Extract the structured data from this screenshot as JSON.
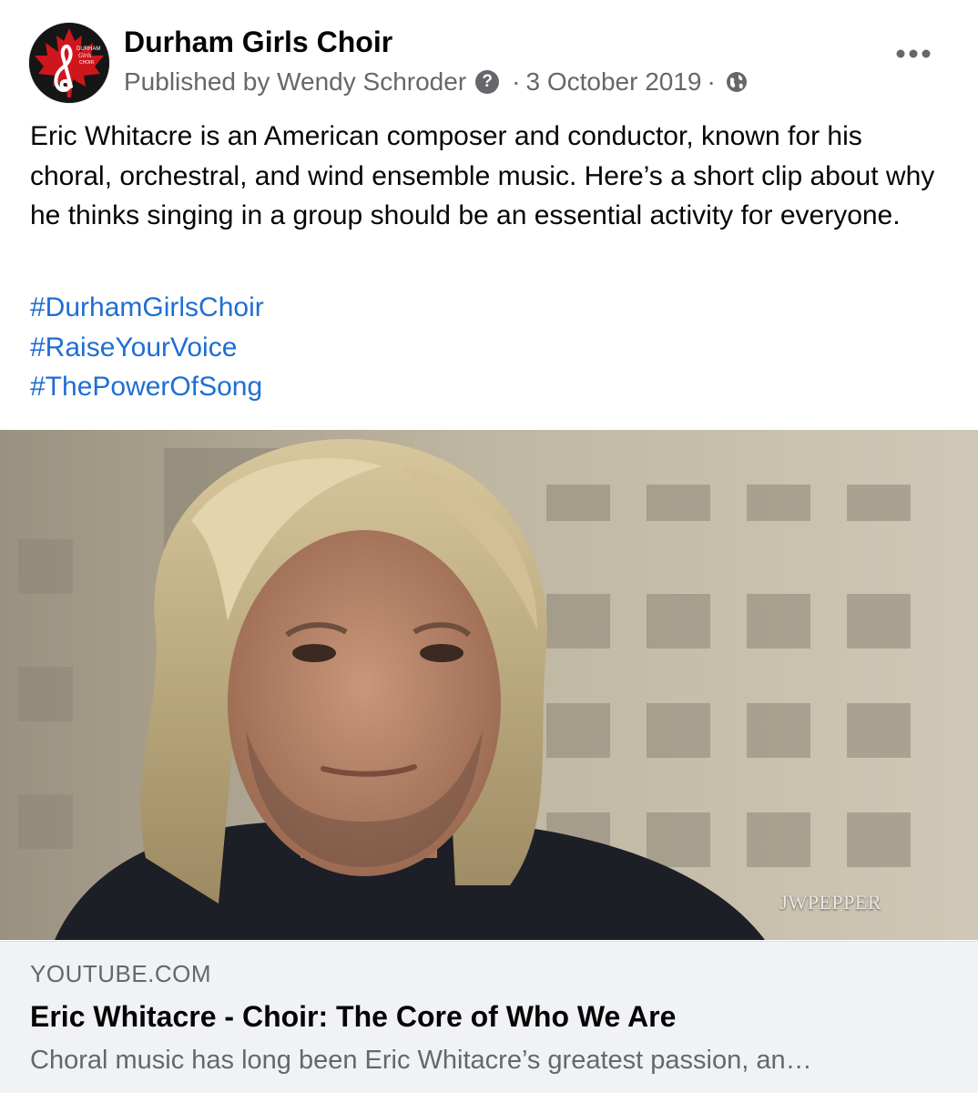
{
  "post": {
    "page_name": "Durham Girls Choir",
    "meta": {
      "published_by": "Published by Wendy Schroder",
      "help_glyph": "?",
      "separator": "·",
      "date": "3 October 2019",
      "audience_icon": "globe-icon"
    },
    "avatar": {
      "logo_text": [
        "DURHAM",
        "Girls",
        "CHOIR"
      ],
      "colors": {
        "leaf": "#d0161d",
        "background": "#161616",
        "clef": "#ffffff"
      }
    },
    "text": "Eric Whitacre is an American composer and conductor, known for his choral, orchestral, and wind ensemble music. Here’s a short clip about why he thinks singing in a group should be an essential activity for everyone.",
    "hashtags": [
      "#DurhamGirlsChoir",
      "#RaiseYourVoice",
      "#ThePowerOfSong"
    ],
    "more_icon": "more-horizontal-icon"
  },
  "link_preview": {
    "watermark": "JWPEPPER",
    "domain": "YOUTUBE.COM",
    "title": "Eric Whitacre - Choir: The Core of Who We Are",
    "description": "Choral music has long been Eric Whitacre’s greatest passion, an…"
  },
  "colors": {
    "hashtag": "#1f6ed4",
    "secondary_text": "#65676b",
    "card_background": "#f0f2f5"
  }
}
